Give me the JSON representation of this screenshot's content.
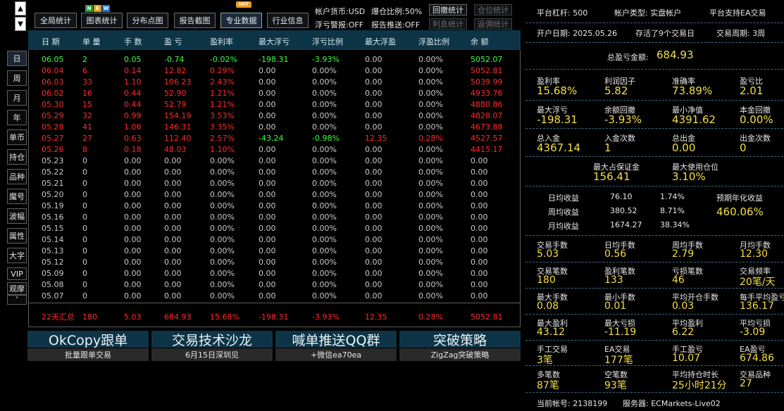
{
  "toolbar": {
    "buttons": [
      "全局统计",
      "图表统计",
      "分布点图",
      "报告截图",
      "专业数据",
      "行业信息"
    ],
    "new_badge": [
      "N",
      "E",
      "W"
    ],
    "hot_badge": "HOT"
  },
  "status": {
    "currency": "帐户货币:USD",
    "margin_ratio": "爆仓比例:50%",
    "float_loss_alert": "浮亏警报:OFF",
    "report_push": "报告推送:OFF",
    "btn_drawdown": "回撤统计",
    "btn_position": "仓位统计",
    "btn_interest": "利息统计",
    "btn_rebate": "返佣统计"
  },
  "table": {
    "headers": [
      "日 期",
      "单 量",
      "手 数",
      "盈 亏",
      "盈利率",
      "最大浮亏",
      "浮亏比例",
      "最大浮盈",
      "浮盈比例",
      "余 额"
    ],
    "rows": [
      {
        "c": [
          "06.05",
          "2",
          "0.05",
          "-0.74",
          "-0.02%",
          "-198.31",
          "-3.93%",
          "0.00",
          "0.00%",
          "5052.07"
        ],
        "color": "green"
      },
      {
        "c": [
          "06.04",
          "6",
          "0.14",
          "12.82",
          "0.29%",
          "0.00",
          "0.00%",
          "0.00",
          "0.00%",
          "5052.81"
        ],
        "color": "red"
      },
      {
        "c": [
          "06.03",
          "33",
          "1.10",
          "106.23",
          "2.43%",
          "0.00",
          "0.00%",
          "0.00",
          "0.00%",
          "5039.99"
        ],
        "color": "red"
      },
      {
        "c": [
          "06.02",
          "16",
          "0.44",
          "52.90",
          "1.21%",
          "0.00",
          "0.00%",
          "0.00",
          "0.00%",
          "4933.76"
        ],
        "color": "red"
      },
      {
        "c": [
          "05.30",
          "15",
          "0.44",
          "52.79",
          "1.21%",
          "0.00",
          "0.00%",
          "0.00",
          "0.00%",
          "4880.86"
        ],
        "color": "red"
      },
      {
        "c": [
          "05.29",
          "32",
          "0.99",
          "154.19",
          "3.53%",
          "0.00",
          "0.00%",
          "0.00",
          "0.00%",
          "4828.07"
        ],
        "color": "red"
      },
      {
        "c": [
          "05.28",
          "41",
          "1.06",
          "146.31",
          "3.35%",
          "0.00",
          "0.00%",
          "0.00",
          "0.00%",
          "4673.88"
        ],
        "color": "red"
      },
      {
        "c": [
          "05.27",
          "27",
          "0.63",
          "112.40",
          "2.57%",
          "-43.24",
          "-0.98%",
          "12.35",
          "0.28%",
          "4527.57"
        ],
        "color": "red"
      },
      {
        "c": [
          "05.26",
          "8",
          "0.18",
          "48.03",
          "1.10%",
          "0.00",
          "0.00%",
          "0.00",
          "0.00%",
          "4415.17"
        ],
        "color": "red"
      },
      {
        "c": [
          "05.23",
          "0",
          "0.00",
          "0.00",
          "0.00%",
          "0.00",
          "0.00%",
          "0.00",
          "0.00%",
          "0.00"
        ],
        "color": "gray"
      },
      {
        "c": [
          "05.22",
          "0",
          "0.00",
          "0.00",
          "0.00%",
          "0.00",
          "0.00%",
          "0.00",
          "0.00%",
          "0.00"
        ],
        "color": "gray"
      },
      {
        "c": [
          "05.21",
          "0",
          "0.00",
          "0.00",
          "0.00%",
          "0.00",
          "0.00%",
          "0.00",
          "0.00%",
          "0.00"
        ],
        "color": "gray"
      },
      {
        "c": [
          "05.20",
          "0",
          "0.00",
          "0.00",
          "0.00%",
          "0.00",
          "0.00%",
          "0.00",
          "0.00%",
          "0.00"
        ],
        "color": "gray"
      },
      {
        "c": [
          "05.19",
          "0",
          "0.00",
          "0.00",
          "0.00%",
          "0.00",
          "0.00%",
          "0.00",
          "0.00%",
          "0.00"
        ],
        "color": "gray"
      },
      {
        "c": [
          "05.16",
          "0",
          "0.00",
          "0.00",
          "0.00%",
          "0.00",
          "0.00%",
          "0.00",
          "0.00%",
          "0.00"
        ],
        "color": "gray"
      },
      {
        "c": [
          "05.15",
          "0",
          "0.00",
          "0.00",
          "0.00%",
          "0.00",
          "0.00%",
          "0.00",
          "0.00%",
          "0.00"
        ],
        "color": "gray"
      },
      {
        "c": [
          "05.14",
          "0",
          "0.00",
          "0.00",
          "0.00%",
          "0.00",
          "0.00%",
          "0.00",
          "0.00%",
          "0.00"
        ],
        "color": "gray"
      },
      {
        "c": [
          "05.13",
          "0",
          "0.00",
          "0.00",
          "0.00%",
          "0.00",
          "0.00%",
          "0.00",
          "0.00%",
          "0.00"
        ],
        "color": "gray"
      },
      {
        "c": [
          "05.12",
          "0",
          "0.00",
          "0.00",
          "0.00%",
          "0.00",
          "0.00%",
          "0.00",
          "0.00%",
          "0.00"
        ],
        "color": "gray"
      },
      {
        "c": [
          "05.09",
          "0",
          "0.00",
          "0.00",
          "0.00%",
          "0.00",
          "0.00%",
          "0.00",
          "0.00%",
          "0.00"
        ],
        "color": "gray"
      },
      {
        "c": [
          "05.08",
          "0",
          "0.00",
          "0.00",
          "0.00%",
          "0.00",
          "0.00%",
          "0.00",
          "0.00%",
          "0.00"
        ],
        "color": "gray"
      },
      {
        "c": [
          "05.07",
          "0",
          "0.00",
          "0.00",
          "0.00%",
          "0.00",
          "0.00%",
          "0.00",
          "0.00%",
          "0.00"
        ],
        "color": "gray"
      }
    ],
    "summary": [
      "22天汇总",
      "180",
      "5.03",
      "684.93",
      "15.68%",
      "-198.31",
      "-3.93%",
      "12.35",
      "0.28%",
      "5052.81"
    ]
  },
  "side_tabs": [
    "日",
    "周",
    "月",
    "年",
    "单币",
    "持仓",
    "品种",
    "魔号",
    "波幅",
    "属性",
    "大字",
    "VIP",
    "观摩"
  ],
  "arrows": {
    "up": "▲",
    "down": "▼",
    "more": "˅"
  },
  "ads": [
    {
      "title": "OkCopy跟单",
      "sub": "批量跟单交易"
    },
    {
      "title": "交易技术沙龙",
      "sub": "6月15日深圳见"
    },
    {
      "title": "喊单推送QQ群",
      "sub": "+微信ea70ea"
    },
    {
      "title": "突破策略",
      "sub": "ZigZag突破策略"
    }
  ],
  "account": {
    "leverage": "平台杠杆:  500",
    "type": "帐户类型:  实盘帐户",
    "ea": "平台支持EA交易",
    "open_date": "开户日期:  2025.05.26",
    "survived": "存活了9个交易日",
    "cycle": "交易周期:  3周",
    "total_pnl_label": "总盈亏金额:",
    "total_pnl_value": "684.93"
  },
  "metrics": {
    "r1": [
      {
        "l": "盈利率",
        "v": "15.68%"
      },
      {
        "l": "利润因子",
        "v": "5.82"
      },
      {
        "l": "准确率",
        "v": "73.89%"
      },
      {
        "l": "盈亏比",
        "v": "2.01"
      }
    ],
    "r2": [
      {
        "l": "最大浮亏",
        "v": "-198.31"
      },
      {
        "l": "余额回撤",
        "v": "-3.93%"
      },
      {
        "l": "最小净值",
        "v": "4391.62"
      },
      {
        "l": "本金回撤",
        "v": "0.00%"
      }
    ],
    "r3": [
      {
        "l": "总入金",
        "v": "4367.14"
      },
      {
        "l": "入金次数",
        "v": "1"
      },
      {
        "l": "总出金",
        "v": "0.00"
      },
      {
        "l": "出金次数",
        "v": "0"
      }
    ],
    "r4": [
      {
        "l": "最大占保证金",
        "v": "156.41"
      },
      {
        "l": "最大使用仓位",
        "v": "3.10%"
      }
    ]
  },
  "income": {
    "daily": {
      "l": "日均收益",
      "v": "76.10",
      "p": "1.74%"
    },
    "weekly": {
      "l": "周均收益",
      "v": "380.52",
      "p": "8.71%"
    },
    "monthly": {
      "l": "月均收益",
      "v": "1674.27",
      "p": "38.34%"
    },
    "annual_label": "预期年化收益",
    "annual_value": "460.06%"
  },
  "stats": {
    "r1": [
      {
        "l": "交易手数",
        "v": "5.03"
      },
      {
        "l": "日均手数",
        "v": "0.56"
      },
      {
        "l": "周均手数",
        "v": "2.79"
      },
      {
        "l": "月均手数",
        "v": "12.30"
      }
    ],
    "r2": [
      {
        "l": "交易笔数",
        "v": "180"
      },
      {
        "l": "盈利笔数",
        "v": "133"
      },
      {
        "l": "亏损笔数",
        "v": "46"
      },
      {
        "l": "交易频率",
        "v": "20笔/天"
      }
    ],
    "r3": [
      {
        "l": "最大手数",
        "v": "0.08"
      },
      {
        "l": "最小手数",
        "v": "0.01"
      },
      {
        "l": "平均开仓手数",
        "v": "0.03"
      },
      {
        "l": "每手平均盈亏",
        "v": "136.17"
      }
    ],
    "r4": [
      {
        "l": "最大盈利",
        "v": "43.12"
      },
      {
        "l": "最大亏损",
        "v": "-11.19"
      },
      {
        "l": "平均盈利",
        "v": "6.22"
      },
      {
        "l": "平均亏损",
        "v": "-3.09"
      }
    ],
    "r5": [
      {
        "l": "手工交易",
        "v": "3笔"
      },
      {
        "l": "EA交易",
        "v": "177笔"
      },
      {
        "l": "手工盈亏",
        "v": "10.07"
      },
      {
        "l": "EA盈亏",
        "v": "674.86"
      }
    ],
    "r6": [
      {
        "l": "多笔数",
        "v": "87笔"
      },
      {
        "l": "空笔数",
        "v": "93笔"
      },
      {
        "l": "平均持仓时长",
        "v": "25小时21分"
      },
      {
        "l": "交易品种",
        "v": "27"
      }
    ]
  },
  "footer": {
    "account_no": "当前帐号:  2138199",
    "server": "服务器:  ECMarkets-Live02"
  },
  "colors": {
    "header_bg": "#0d3547",
    "profit": "#ff2a2a",
    "loss": "#3cff3c",
    "value": "#f4df45",
    "dash": "#3b6c80"
  }
}
